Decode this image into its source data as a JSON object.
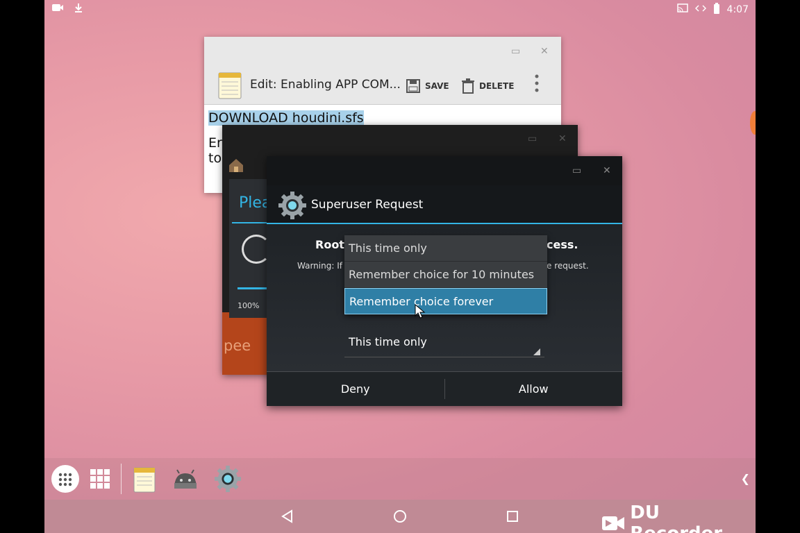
{
  "status_bar": {
    "time": "4:07",
    "left_icons": [
      "video-icon",
      "download-icon"
    ],
    "right_icons": [
      "cast-icon",
      "data-sync-icon",
      "battery-icon"
    ]
  },
  "notes_window": {
    "title": "Edit: Enabling APP COM...",
    "save_label": "SAVE",
    "delete_label": "DELETE",
    "line1": "DOWNLOAD houdini.sfs",
    "line2": "Er",
    "line3": "to"
  },
  "background_window": {
    "title_partial": "Plea",
    "percent": "100%",
    "footer_partial": "pee"
  },
  "superuser_dialog": {
    "title": "Superuser Request",
    "root_left": "Root",
    "root_right": "cess.",
    "warning_left": "Warning: If",
    "warning_right": "e request.",
    "selected_option": "This time only",
    "dropdown_options": [
      "This time only",
      "Remember choice for 10 minutes",
      "Remember choice forever"
    ],
    "highlighted_option_index": 2,
    "deny_label": "Deny",
    "allow_label": "Allow"
  },
  "taskbar": {
    "apps": [
      "app-drawer-icon",
      "grid-icon",
      "notes-app-icon",
      "android-app-icon",
      "superuser-app-icon"
    ],
    "collapse_icon": "chevron-left-icon"
  },
  "navbar": {
    "buttons": [
      "back-icon",
      "home-icon",
      "recents-icon"
    ],
    "watermark": "DU Recorder"
  },
  "colors": {
    "accent": "#33b5e5",
    "highlight": "#2f7fa6",
    "wallpaper": "#e79aa6"
  }
}
